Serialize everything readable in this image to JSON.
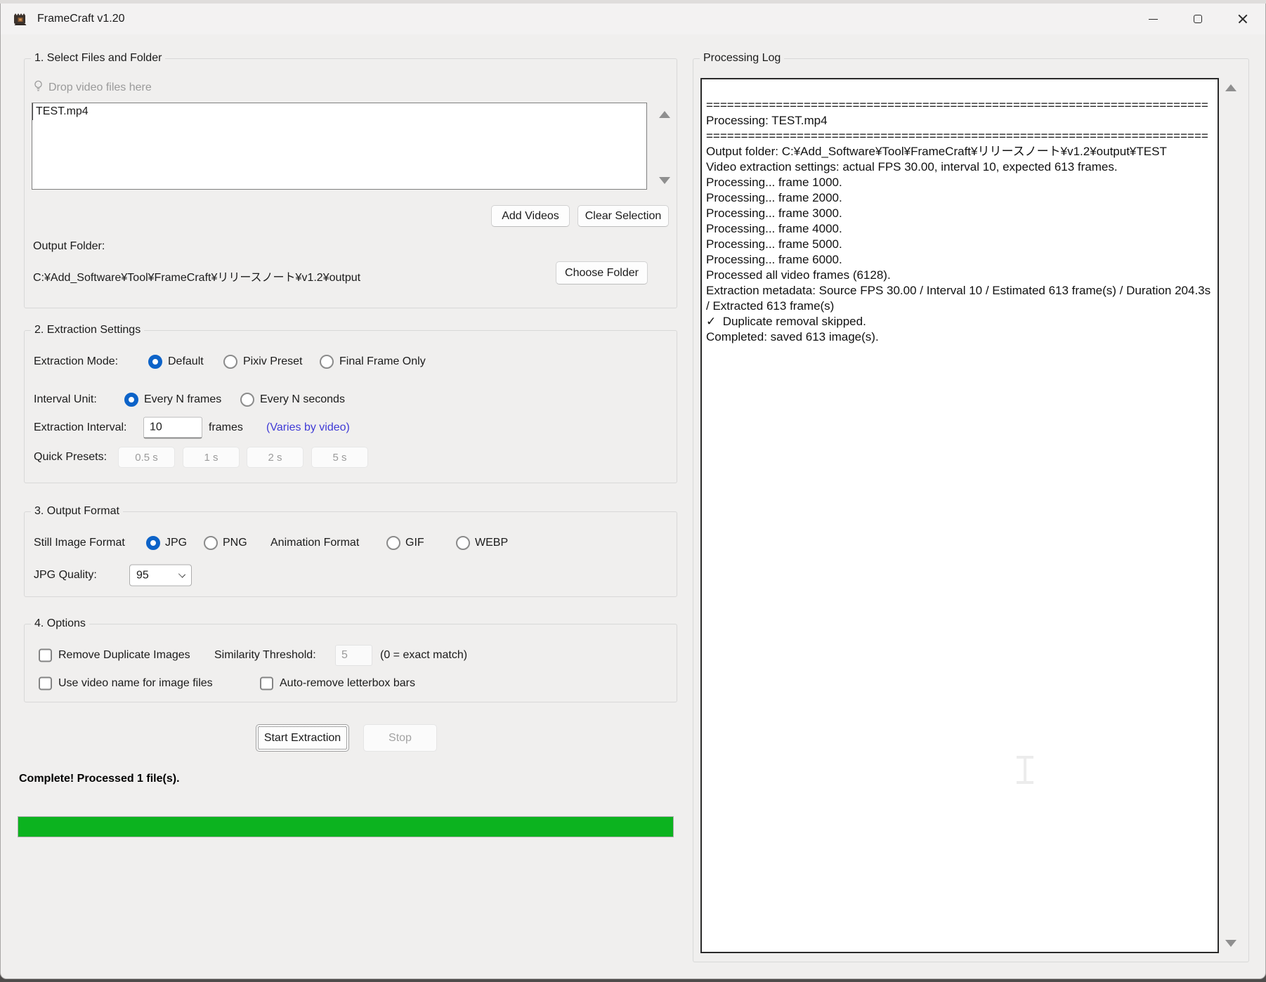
{
  "window": {
    "title": "FrameCraft v1.20",
    "controls": {
      "minimize": "minimize",
      "maximize": "maximize",
      "close": "close"
    }
  },
  "colors": {
    "accent": "#0d63c8",
    "link": "#3f3ad6",
    "progress_green": "#0cb31f"
  },
  "left": {
    "section1": {
      "title": "1. Select Files and Folder",
      "drop_hint": "Drop video files here",
      "files": [
        "TEST.mp4"
      ],
      "add_videos_label": "Add Videos",
      "clear_selection_label": "Clear Selection",
      "output_folder_label": "Output Folder:",
      "output_folder_path": "C:¥Add_Software¥Tool¥FrameCraft¥リリースノート¥v1.2¥output",
      "choose_folder_label": "Choose Folder"
    },
    "section2": {
      "title": "2. Extraction Settings",
      "mode_label": "Extraction Mode:",
      "modes": [
        {
          "label": "Default",
          "selected": true
        },
        {
          "label": "Pixiv Preset",
          "selected": false
        },
        {
          "label": "Final Frame Only",
          "selected": false
        }
      ],
      "interval_unit_label": "Interval Unit:",
      "units": [
        {
          "label": "Every N frames",
          "selected": true
        },
        {
          "label": "Every N seconds",
          "selected": false
        }
      ],
      "interval_label": "Extraction Interval:",
      "interval_value": "10",
      "interval_suffix": "frames",
      "varies_note": "(Varies by video)",
      "presets_label": "Quick Presets:",
      "presets": [
        "0.5 s",
        "1 s",
        "2 s",
        "5 s"
      ]
    },
    "section3": {
      "title": "3. Output Format",
      "still_label": "Still Image Format",
      "still_options": [
        {
          "label": "JPG",
          "selected": true
        },
        {
          "label": "PNG",
          "selected": false
        }
      ],
      "anim_label": "Animation Format",
      "anim_options": [
        {
          "label": "GIF",
          "selected": false
        },
        {
          "label": "WEBP",
          "selected": false
        }
      ],
      "quality_label": "JPG Quality:",
      "quality_value": "95"
    },
    "section4": {
      "title": "4. Options",
      "remove_duplicates_label": "Remove Duplicate Images",
      "remove_duplicates_checked": false,
      "similarity_label": "Similarity Threshold:",
      "similarity_value": "5",
      "similarity_hint": "(0 = exact match)",
      "video_name_label": "Use video name for image files",
      "video_name_checked": false,
      "letterbox_label": "Auto-remove letterbox bars",
      "letterbox_checked": false
    },
    "actions": {
      "start_label": "Start Extraction",
      "stop_label": "Stop"
    },
    "status_text": "Complete! Processed 1 file(s).",
    "progress_percent": 100
  },
  "log": {
    "title": "Processing Log",
    "lines": [
      "",
      "========================================================================",
      "Processing: TEST.mp4",
      "========================================================================",
      "Output folder: C:¥Add_Software¥Tool¥FrameCraft¥リリースノート¥v1.2¥output¥TEST",
      "Video extraction settings: actual FPS 30.00, interval 10, expected 613 frames.",
      "Processing... frame 1000.",
      "Processing... frame 2000.",
      "Processing... frame 3000.",
      "Processing... frame 4000.",
      "Processing... frame 5000.",
      "Processing... frame 6000.",
      "Processed all video frames (6128).",
      "Extraction metadata: Source FPS 30.00 / Interval 10 / Estimated 613 frame(s) / Duration 204.3s / Extracted 613 frame(s)",
      "✓  Duplicate removal skipped.",
      "Completed: saved 613 image(s)."
    ]
  }
}
